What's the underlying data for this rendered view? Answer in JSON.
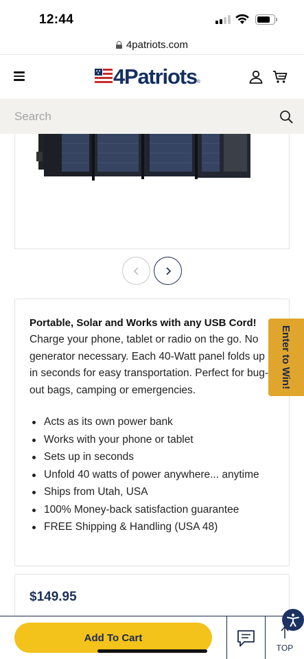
{
  "status_bar": {
    "time": "12:44"
  },
  "browser": {
    "url": "4patriots.com"
  },
  "header": {
    "logo_text": "4Patriots",
    "logo_reg": "®"
  },
  "search": {
    "placeholder": "Search"
  },
  "product": {
    "headline": "Portable, Solar and Works with any USB Cord!",
    "description": "Charge your phone, tablet or radio on the go. No generator necessary. Each 40-Watt panel folds up in seconds for easy transportation. Perfect for bug-out bags, camping or emergencies.",
    "bullets": [
      "Acts as its own power bank",
      "Works with your phone or tablet",
      "Sets up in seconds",
      "Unfold 40 watts of power anywhere... anytime",
      "Ships from Utah, USA",
      "100% Money-back satisfaction guarantee",
      "FREE Shipping & Handling (USA 48)"
    ],
    "price": "$149.95"
  },
  "promo": {
    "win_tab_label": "Enter to Win!"
  },
  "bottom_bar": {
    "add_to_cart_label": "Add To Cart",
    "top_label": "TOP"
  },
  "colors": {
    "navy": "#1b2a4a",
    "gold": "#f3c21b",
    "win_tab": "#e0a52d",
    "logo_blue": "#14305f"
  },
  "icons": [
    "lock-icon",
    "hamburger-icon",
    "user-icon",
    "cart-icon",
    "search-icon",
    "chevron-left-icon",
    "chevron-right-icon",
    "chat-icon",
    "arrow-up-icon",
    "accessibility-icon"
  ]
}
